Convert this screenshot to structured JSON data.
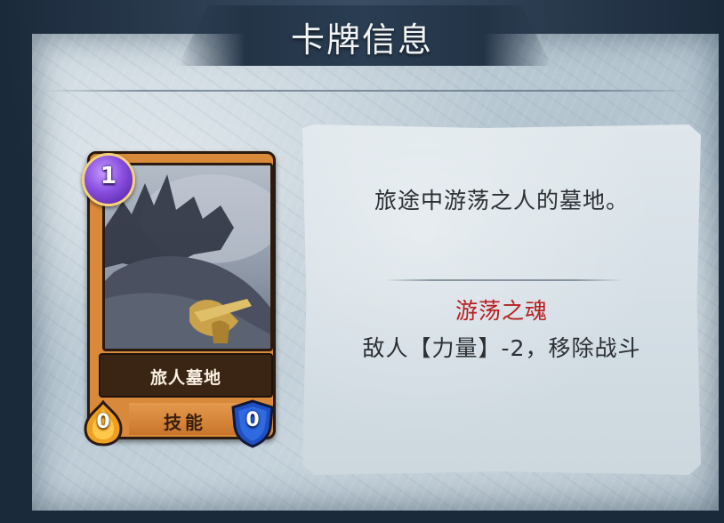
{
  "header": {
    "title": "卡牌信息"
  },
  "card": {
    "name": "旅人墓地",
    "type_label": "技能",
    "cost": "1",
    "attack": "0",
    "defense": "0",
    "art_icon": "ruined-shipwreck-art"
  },
  "info": {
    "flavor_text": "旅途中游荡之人的墓地。",
    "skill_name": "游荡之魂",
    "skill_description": "敌人【力量】-2，移除战斗"
  },
  "colors": {
    "skill_name": "#b81e1e",
    "card_frame": "#d88a3a",
    "cost_gem": "#8a4fe0",
    "attack_badge": "#f0a020",
    "defense_shield": "#1f4fc0"
  }
}
